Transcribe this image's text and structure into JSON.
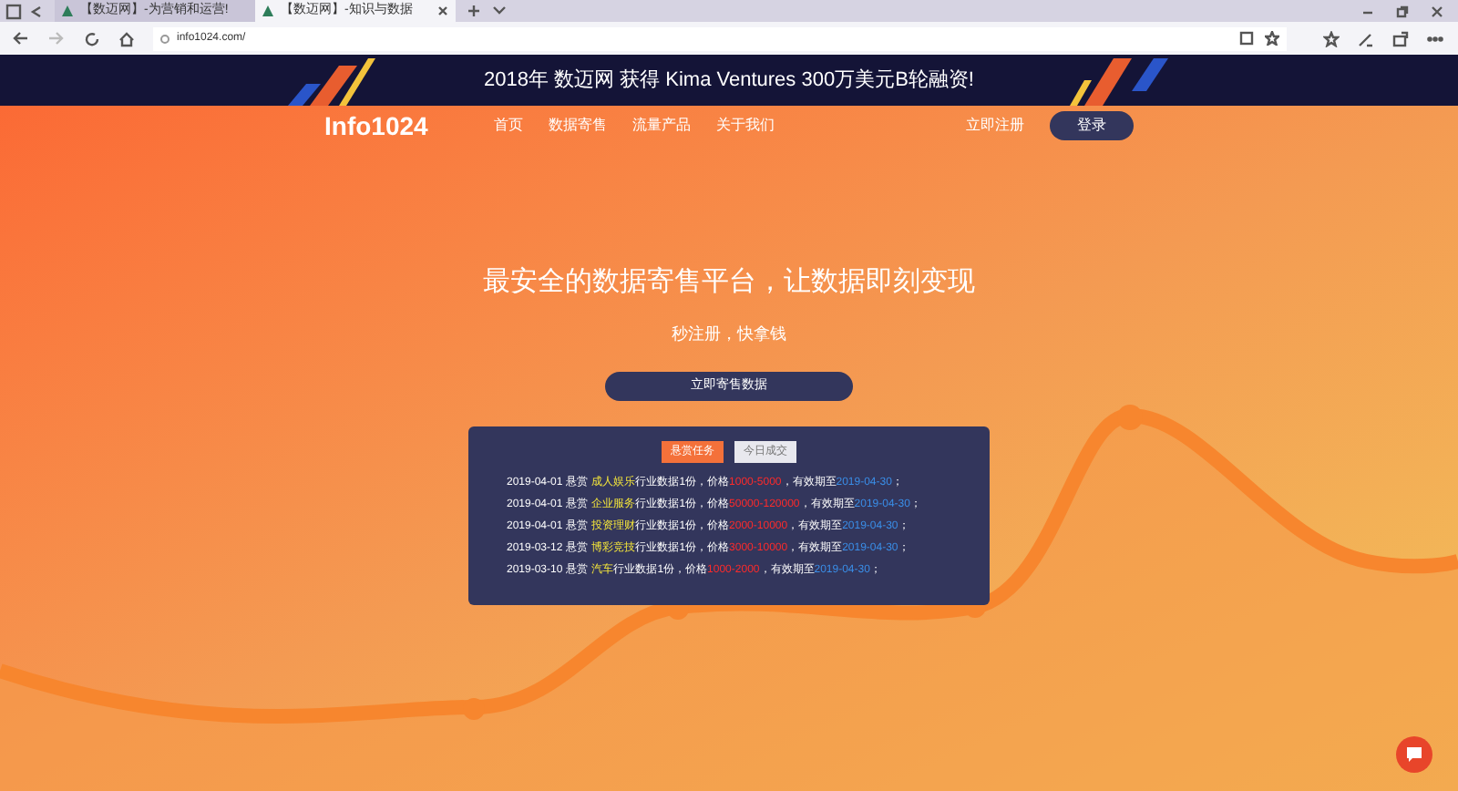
{
  "browser": {
    "tabs": [
      {
        "title": "【数迈网】-为营销和运营!",
        "selected": false
      },
      {
        "title": "【数迈网】-知识与数据",
        "selected": true
      }
    ],
    "address": "info1024.com/"
  },
  "banner": {
    "text": "2018年 数迈网 获得 Kima Ventures 300万美元B轮融资!"
  },
  "nav": {
    "logo": "Info1024",
    "links": [
      "首页",
      "数据寄售",
      "流量产品",
      "关于我们"
    ],
    "register": "立即注册",
    "login": "登录"
  },
  "hero": {
    "title": "最安全的数据寄售平台，让数据即刻变现",
    "subtitle": "秒注册，快拿钱",
    "cta": "立即寄售数据"
  },
  "panel": {
    "tabs": [
      {
        "label": "悬赏任务",
        "selected": true
      },
      {
        "label": "今日成交",
        "selected": false
      }
    ],
    "rows": [
      {
        "date": "2019-04-01",
        "verb": "悬赏",
        "category": "成人娱乐",
        "mid": "行业数据1份，价格",
        "price": "1000-5000",
        "valid": "，有效期至",
        "expires": "2019-04-30",
        "end": "；"
      },
      {
        "date": "2019-04-01",
        "verb": "悬赏",
        "category": "企业服务",
        "mid": "行业数据1份，价格",
        "price": "50000-120000",
        "valid": "，有效期至",
        "expires": "2019-04-30",
        "end": "；"
      },
      {
        "date": "2019-04-01",
        "verb": "悬赏",
        "category": "投资理财",
        "mid": "行业数据1份，价格",
        "price": "2000-10000",
        "valid": "，有效期至",
        "expires": "2019-04-30",
        "end": "；"
      },
      {
        "date": "2019-03-12",
        "verb": "悬赏",
        "category": "博彩竞技",
        "mid": "行业数据1份，价格",
        "price": "3000-10000",
        "valid": "，有效期至",
        "expires": "2019-04-30",
        "end": "；"
      },
      {
        "date": "2019-03-10",
        "verb": "悬赏",
        "category": "汽车",
        "mid": "行业数据1份，价格",
        "price": "1000-2000",
        "valid": "，有效期至",
        "expires": "2019-04-30",
        "end": "；"
      }
    ]
  }
}
